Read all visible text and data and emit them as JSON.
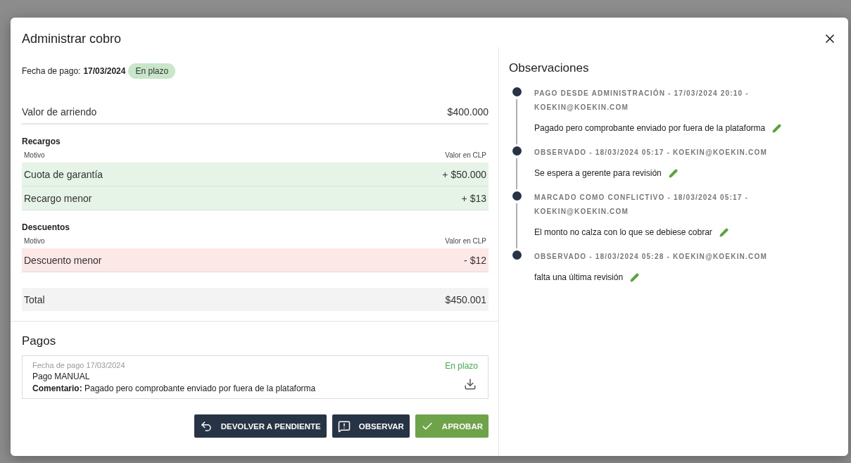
{
  "dialog": {
    "title": "Administrar cobro"
  },
  "payment_date": {
    "label": "Fecha de pago:",
    "value": "17/03/2024",
    "status": "En plazo"
  },
  "rent": {
    "label": "Valor de arriendo",
    "value": "$400.000"
  },
  "surcharges": {
    "title": "Recargos",
    "columns": [
      "Motivo",
      "Valor en CLP"
    ],
    "kind": "surcharge",
    "rows": [
      {
        "reason": "Cuota de garantía",
        "value": "+ $50.000"
      },
      {
        "reason": "Recargo menor",
        "value": "+ $13"
      }
    ]
  },
  "discounts": {
    "title": "Descuentos",
    "columns": [
      "Motivo",
      "Valor en CLP"
    ],
    "kind": "discount",
    "rows": [
      {
        "reason": "Descuento menor",
        "value": "- $12"
      }
    ]
  },
  "total": {
    "label": "Total",
    "value": "$450.001"
  },
  "payments": {
    "title": "Pagos",
    "items": [
      {
        "date": "Fecha de pago 17/03/2024",
        "status": "En plazo",
        "method": "Pago MANUAL",
        "comment": "**Comentario:** Pagado pero comprobante enviado por fuera de la plataforma"
      }
    ]
  },
  "actions": [
    {
      "label": "DEVOLVER A PENDIENTE",
      "kind": "undo"
    },
    {
      "label": "OBSERVAR",
      "kind": "observe"
    },
    {
      "label": "APROBAR",
      "kind": "approve"
    }
  ],
  "observations": {
    "title": "Observaciones",
    "entries": [
      {
        "header": "PAGO DESDE ADMINISTRACIÓN - 17/03/2024 20:10 - KOEKIN@KOEKIN.COM",
        "text": "Pagado pero comprobante enviado por fuera de la plataforma"
      },
      {
        "header": "OBSERVADO - 18/03/2024 05:17 - KOEKIN@KOEKIN.COM",
        "text": "Se espera a gerente para revisión"
      },
      {
        "header": "MARCADO COMO CONFLICTIVO - 18/03/2024 05:17 - KOEKIN@KOEKIN.COM",
        "text": "El monto no calza con lo que se debiese cobrar"
      },
      {
        "header": "OBSERVADO - 18/03/2024 05:28 - KOEKIN@KOEKIN.COM",
        "text": "falta una última revisión"
      }
    ]
  }
}
